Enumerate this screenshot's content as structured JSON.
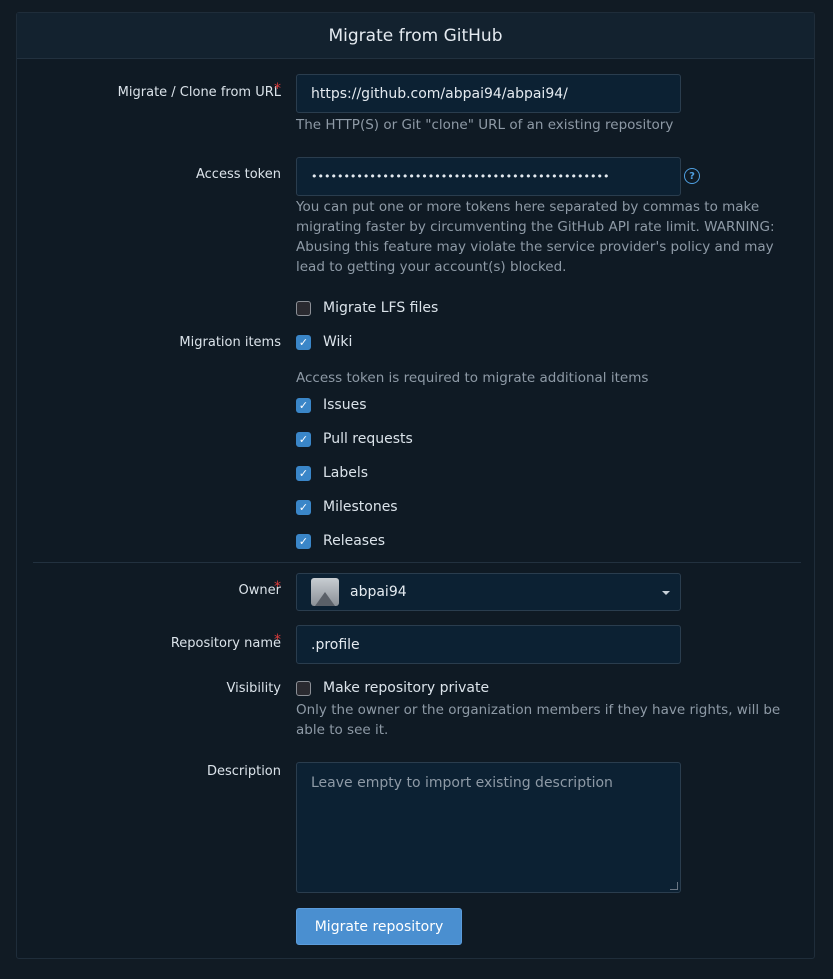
{
  "header": {
    "title": "Migrate from GitHub"
  },
  "url": {
    "label": "Migrate / Clone from URL",
    "required_mark": "*",
    "value": "https://github.com/abpai94/abpai94/",
    "help": "The HTTP(S) or Git \"clone\" URL of an existing repository"
  },
  "token": {
    "label": "Access token",
    "value": "••••••••••••••••••••••••••••••••••••••••••••••",
    "help_icon": "?",
    "help": "You can put one or more tokens here separated by commas to make migrating faster by circumventing the GitHub API rate limit. WARNING: Abusing this feature may violate the service provider's policy and may lead to getting your account(s) blocked."
  },
  "lfs": {
    "label": "Migrate LFS files",
    "checked": false
  },
  "migration_items": {
    "label": "Migration items",
    "wiki": {
      "label": "Wiki",
      "checked": true
    },
    "note": "Access token is required to migrate additional items",
    "items": [
      {
        "label": "Issues",
        "checked": true
      },
      {
        "label": "Pull requests",
        "checked": true
      },
      {
        "label": "Labels",
        "checked": true
      },
      {
        "label": "Milestones",
        "checked": true
      },
      {
        "label": "Releases",
        "checked": true
      }
    ]
  },
  "owner": {
    "label": "Owner",
    "required_mark": "*",
    "value": "abpai94"
  },
  "repo_name": {
    "label": "Repository name",
    "required_mark": "*",
    "value": ".profile"
  },
  "visibility": {
    "label": "Visibility",
    "checkbox_label": "Make repository private",
    "checked": false,
    "help": "Only the owner or the organization members if they have rights, will be able to see it."
  },
  "description": {
    "label": "Description",
    "placeholder": "Leave empty to import existing description"
  },
  "submit": {
    "label": "Migrate repository"
  },
  "checkmark": "✓",
  "colors": {
    "accent": "#4a8fd0",
    "required": "#db3b3b",
    "background": "#111b24"
  }
}
